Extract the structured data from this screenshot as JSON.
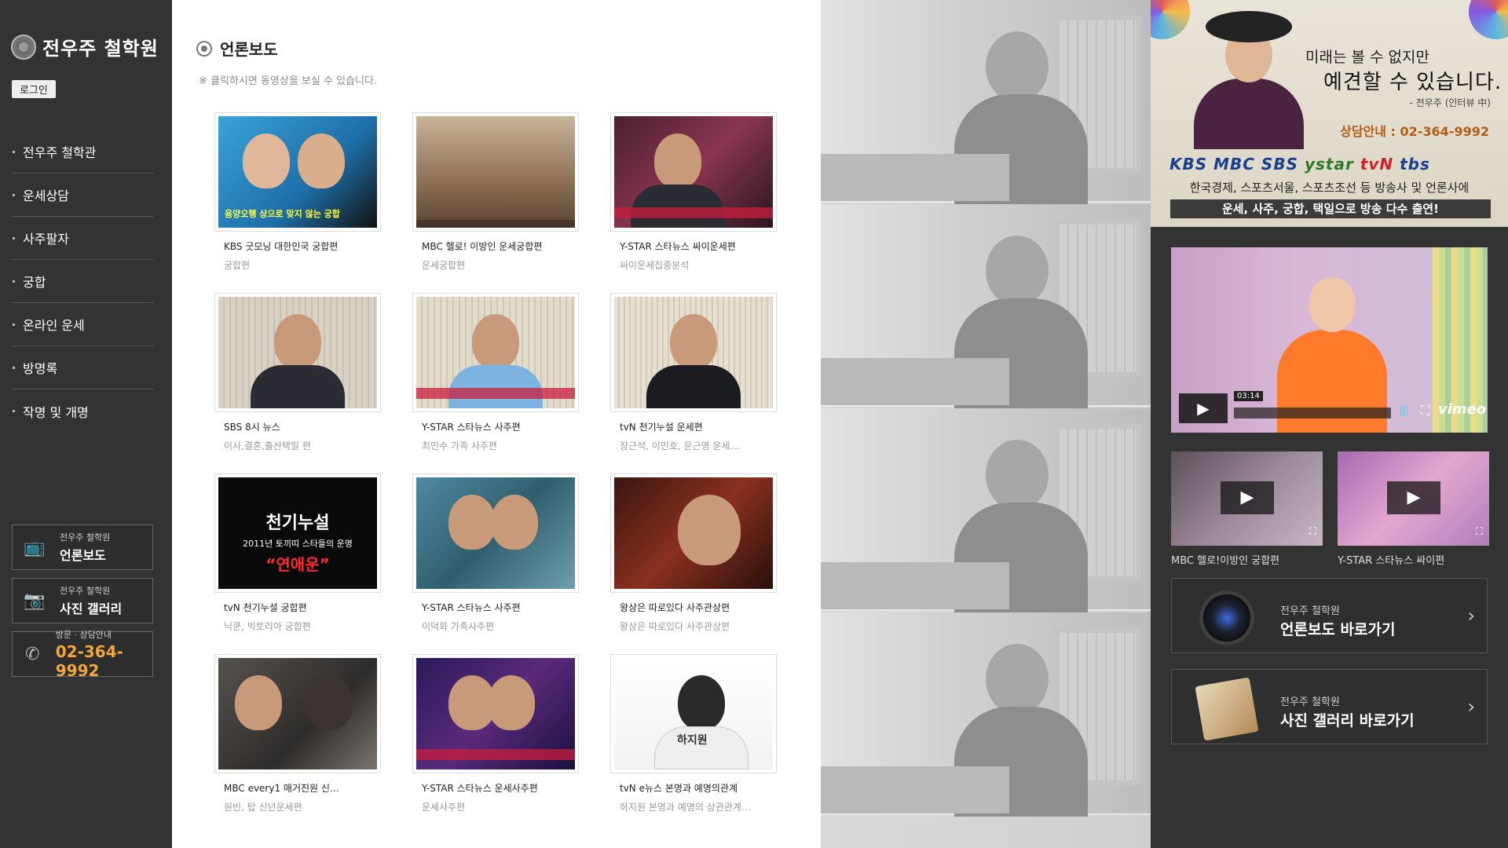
{
  "sidebar": {
    "logo_text": "전우주 철학원",
    "login": "로그인",
    "nav": [
      "전우주 철학관",
      "운세상담",
      "사주팔자",
      "궁합",
      "온라인 운세",
      "방명록",
      "작명 및 개명"
    ],
    "cards": [
      {
        "small": "전우주 철학원",
        "big": "언론보도",
        "icon": "tv-icon"
      },
      {
        "small": "전우주 철학원",
        "big": "사진 갤러리",
        "icon": "camera-icon"
      },
      {
        "small": "방문 · 상담안내",
        "big": "02-364-9992",
        "icon": "phone-icon"
      }
    ]
  },
  "main": {
    "title": "언론보도",
    "subtitle": "※ 클릭하시면 동영상을 보실 수 있습니다.",
    "videos": [
      {
        "name": "KBS 굿모닝 대한민국 궁합편",
        "desc": "궁합편",
        "overlay": "음양오행 상으로 맞지 않는 궁합"
      },
      {
        "name": "MBC 헬로! 이방인 운세궁합편",
        "desc": "운세궁합편",
        "overlay": ""
      },
      {
        "name": "Y-STAR 스타뉴스 싸이운세편",
        "desc": "싸이운세집중분석",
        "overlay": ""
      },
      {
        "name": "SBS 8시 뉴스",
        "desc": "이사,결혼,출산택일 편",
        "overlay": ""
      },
      {
        "name": "Y-STAR 스타뉴스 사주편",
        "desc": "최민수 가족 사주편",
        "overlay": ""
      },
      {
        "name": "tvN 천기누설 운세편",
        "desc": "장근석, 이민호, 문근영 운세…",
        "overlay": ""
      },
      {
        "name": "tvN 천기누설 궁합편",
        "desc": "닉쿤, 빅토리아 궁합편",
        "overlay_title": "천기누설",
        "overlay_sub": "2011년 토끼띠 스타들의 운명",
        "overlay_red": "“연애운”"
      },
      {
        "name": "Y-STAR 스타뉴스 사주편",
        "desc": "이덕화 가족사주편",
        "overlay": ""
      },
      {
        "name": "왕상은 따로있다 사주관상편",
        "desc": "왕상은 따로있다 사주관상편",
        "overlay": ""
      },
      {
        "name": "MBC every1 매거진원 신…",
        "desc": "원빈, 탑 신년운세편",
        "overlay": ""
      },
      {
        "name": "Y-STAR 스타뉴스 운세사주편",
        "desc": "운세사주편",
        "overlay": ""
      },
      {
        "name": "tvN e뉴스 본명과 예명의관계",
        "desc": "하지원 본명과 예명의 상관관계…",
        "overlay": "하지원"
      }
    ]
  },
  "banner": {
    "slogan1": "미래는 볼 수 없지만",
    "slogan2": "예견할 수 있습니다.",
    "quote": "- 전우주 (인터뷰 中)",
    "phone": "상담안내 : 02-364-9992",
    "logos": [
      "KBS",
      "MBC",
      "SBS",
      "ystar",
      "tvN",
      "tbs"
    ],
    "notice": "한국경제, 스포츠서울, 스포츠조선 등 방송사 및 언론사에",
    "strip": "운세, 사주, 궁합, 택일으로 방송 다수 출연!"
  },
  "player": {
    "time": "03:14",
    "brand": "vimeo"
  },
  "mini_videos": [
    {
      "caption": "MBC 헬로!이방인 궁합편"
    },
    {
      "caption": "Y-STAR 스타뉴스 싸이편"
    }
  ],
  "goto": [
    {
      "small": "전우주 철학원",
      "big": "언론보도 바로가기"
    },
    {
      "small": "전우주 철학원",
      "big": "사진 갤러리 바로가기"
    }
  ]
}
